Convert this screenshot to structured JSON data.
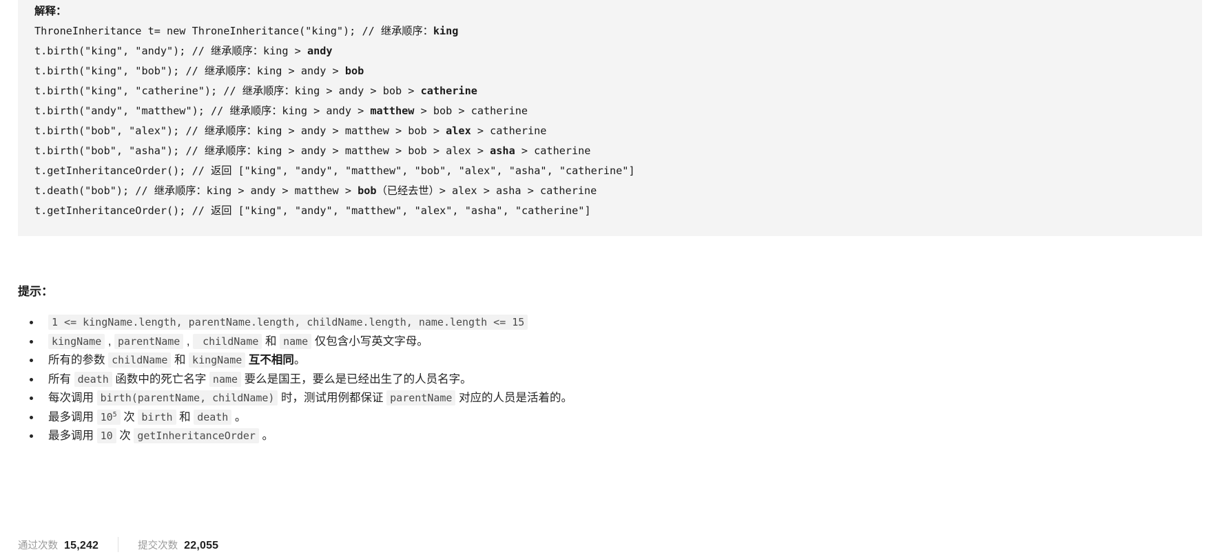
{
  "explanation": {
    "title": "解释：",
    "lines": [
      [
        {
          "t": "ThroneInheritance t= new ThroneInheritance(\"king\"); // 继承顺序：",
          "b": false
        },
        {
          "t": "king",
          "b": true
        }
      ],
      [
        {
          "t": "t.birth(\"king\", \"andy\"); // 继承顺序：king > ",
          "b": false
        },
        {
          "t": "andy",
          "b": true
        }
      ],
      [
        {
          "t": "t.birth(\"king\", \"bob\"); // 继承顺序：king > andy > ",
          "b": false
        },
        {
          "t": "bob",
          "b": true
        }
      ],
      [
        {
          "t": "t.birth(\"king\", \"catherine\"); // 继承顺序：king > andy > bob > ",
          "b": false
        },
        {
          "t": "catherine",
          "b": true
        }
      ],
      [
        {
          "t": "t.birth(\"andy\", \"matthew\"); // 继承顺序：king > andy > ",
          "b": false
        },
        {
          "t": "matthew",
          "b": true
        },
        {
          "t": " > bob > catherine",
          "b": false
        }
      ],
      [
        {
          "t": "t.birth(\"bob\", \"alex\"); // 继承顺序：king > andy > matthew > bob > ",
          "b": false
        },
        {
          "t": "alex",
          "b": true
        },
        {
          "t": " > catherine",
          "b": false
        }
      ],
      [
        {
          "t": "t.birth(\"bob\", \"asha\"); // 继承顺序：king > andy > matthew > bob > alex > ",
          "b": false
        },
        {
          "t": "asha",
          "b": true
        },
        {
          "t": " > catherine",
          "b": false
        }
      ],
      [
        {
          "t": "t.getInheritanceOrder(); // 返回 [\"king\", \"andy\", \"matthew\", \"bob\", \"alex\", \"asha\", \"catherine\"]",
          "b": false
        }
      ],
      [
        {
          "t": "t.death(\"bob\"); // 继承顺序：king > andy > matthew > ",
          "b": false
        },
        {
          "t": "bob",
          "b": true
        },
        {
          "t": "（已经去世）> alex > asha > catherine",
          "b": false
        }
      ],
      [
        {
          "t": "t.getInheritanceOrder(); // 返回 [\"king\", \"andy\", \"matthew\", \"alex\", \"asha\", \"catherine\"]",
          "b": false
        }
      ]
    ]
  },
  "hints": {
    "title": "提示：",
    "items": [
      [
        {
          "type": "code",
          "t": "1 <= kingName.length, parentName.length, childName.length, name.length <= 15"
        }
      ],
      [
        {
          "type": "code",
          "t": "kingName"
        },
        {
          "type": "text",
          "t": " , "
        },
        {
          "type": "code",
          "t": "parentName"
        },
        {
          "type": "text",
          "t": " , "
        },
        {
          "type": "code",
          "t": " childName"
        },
        {
          "type": "text",
          "t": " 和 "
        },
        {
          "type": "code",
          "t": "name"
        },
        {
          "type": "text",
          "t": " 仅包含小写英文字母。"
        }
      ],
      [
        {
          "type": "text",
          "t": "所有的参数 "
        },
        {
          "type": "code",
          "t": "childName"
        },
        {
          "type": "text",
          "t": " 和 "
        },
        {
          "type": "code",
          "t": "kingName"
        },
        {
          "type": "text",
          "t": " "
        },
        {
          "type": "bold",
          "t": "互不相同"
        },
        {
          "type": "text",
          "t": "。"
        }
      ],
      [
        {
          "type": "text",
          "t": "所有 "
        },
        {
          "type": "code",
          "t": "death"
        },
        {
          "type": "text",
          "t": " 函数中的死亡名字 "
        },
        {
          "type": "code",
          "t": "name"
        },
        {
          "type": "text",
          "t": " 要么是国王，要么是已经出生了的人员名字。"
        }
      ],
      [
        {
          "type": "text",
          "t": "每次调用 "
        },
        {
          "type": "code",
          "t": "birth(parentName, childName)"
        },
        {
          "type": "text",
          "t": " 时，测试用例都保证 "
        },
        {
          "type": "code",
          "t": "parentName"
        },
        {
          "type": "text",
          "t": " 对应的人员是活着的。"
        }
      ],
      [
        {
          "type": "text",
          "t": "最多调用 "
        },
        {
          "type": "code_sup",
          "t": "10",
          "sup": "5"
        },
        {
          "type": "text",
          "t": " 次 "
        },
        {
          "type": "code",
          "t": "birth"
        },
        {
          "type": "text",
          "t": " 和 "
        },
        {
          "type": "code",
          "t": "death"
        },
        {
          "type": "text",
          "t": " 。"
        }
      ],
      [
        {
          "type": "text",
          "t": "最多调用 "
        },
        {
          "type": "code",
          "t": "10"
        },
        {
          "type": "text",
          "t": " 次 "
        },
        {
          "type": "code",
          "t": "getInheritanceOrder"
        },
        {
          "type": "text",
          "t": " 。"
        }
      ]
    ]
  },
  "stats": {
    "accepted_label": "通过次数",
    "accepted_value": "15,242",
    "submissions_label": "提交次数",
    "submissions_value": "22,055"
  },
  "colors": {
    "code_block_bg": "#f4f4f4",
    "inline_code_bg": "#f2f2f2",
    "inline_code_fg": "#4a4a4a",
    "text": "#1a1a1a",
    "muted": "#9a9a9a",
    "divider": "#e0e0e0"
  }
}
